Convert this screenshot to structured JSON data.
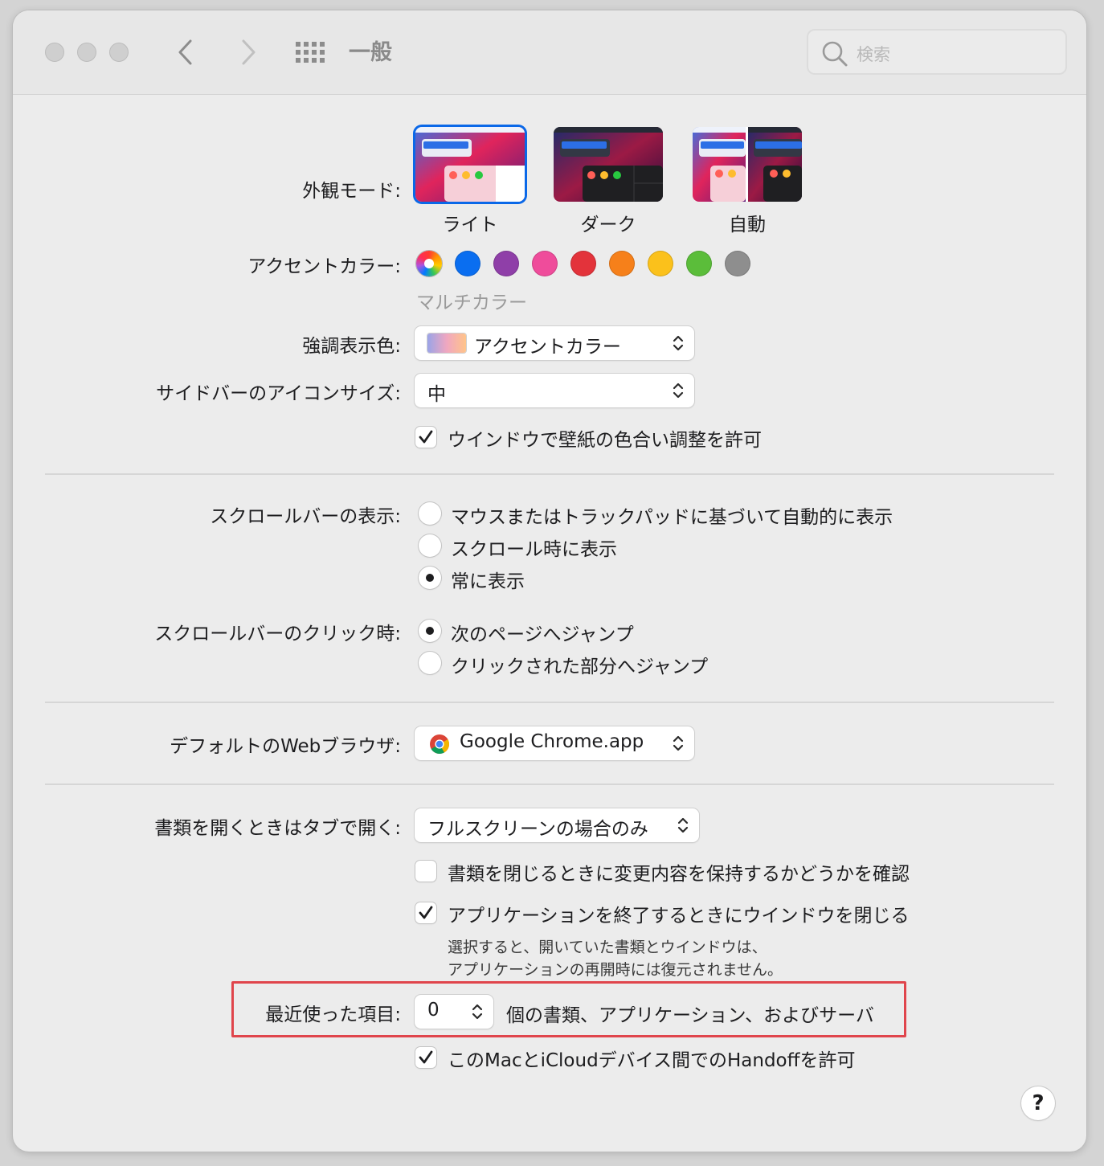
{
  "window": {
    "title": "一般",
    "search_placeholder": "検索"
  },
  "appearance": {
    "label": "外観モード:",
    "options": [
      "ライト",
      "ダーク",
      "自動"
    ],
    "selected": "ライト"
  },
  "accent": {
    "label": "アクセントカラー:",
    "selected_name": "マルチカラー",
    "colors": [
      "#3b6fdf",
      "#0a6ef0",
      "#8f3fa8",
      "#ef4c9b",
      "#e3333b",
      "#f6801a",
      "#fbc11b",
      "#5bbd3a",
      "#8e8e8e"
    ]
  },
  "highlight_color": {
    "label": "強調表示色:",
    "value": "アクセントカラー"
  },
  "sidebar_icon_size": {
    "label": "サイドバーのアイコンサイズ:",
    "value": "中"
  },
  "wallpaper_tinting": {
    "label": "ウインドウで壁紙の色合い調整を許可",
    "checked": true
  },
  "show_scroll_bars": {
    "label": "スクロールバーの表示:",
    "options": [
      "マウスまたはトラックパッドに基づいて自動的に表示",
      "スクロール時に表示",
      "常に表示"
    ],
    "selected_index": 2
  },
  "click_scroll_bar": {
    "label": "スクロールバーのクリック時:",
    "options": [
      "次のページへジャンプ",
      "クリックされた部分へジャンプ"
    ],
    "selected_index": 0
  },
  "default_browser": {
    "label": "デフォルトのWebブラウザ:",
    "value": "Google Chrome.app"
  },
  "prefer_tabs": {
    "label": "書類を開くときはタブで開く:",
    "value": "フルスクリーンの場合のみ"
  },
  "ask_keep_changes": {
    "label": "書類を閉じるときに変更内容を保持するかどうかを確認",
    "checked": false
  },
  "close_windows": {
    "label": "アプリケーションを終了するときにウインドウを閉じる",
    "checked": true,
    "note_line1": "選択すると、開いていた書類とウインドウは、",
    "note_line2": "アプリケーションの再開時には復元されません。"
  },
  "recent_items": {
    "label": "最近使った項目:",
    "value": "0",
    "suffix": "個の書類、アプリケーション、およびサーバ"
  },
  "handoff": {
    "label": "このMacとiCloudデバイス間でのHandoffを許可",
    "checked": true
  },
  "help_button": "?"
}
